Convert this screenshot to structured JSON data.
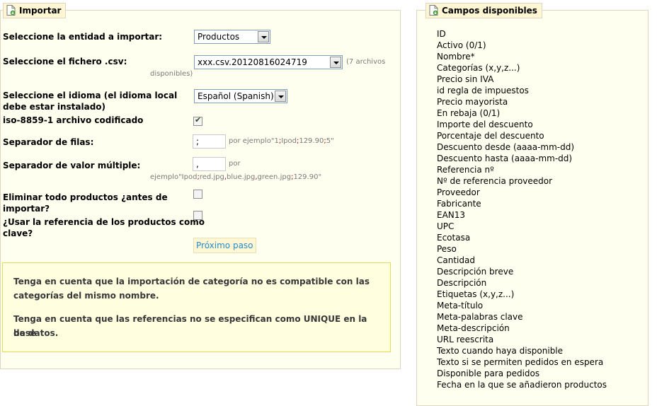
{
  "import": {
    "legend": "Importar",
    "entity_label": "Seleccione la entidad a importar:",
    "entity_value": "Productos",
    "file_label": "Seleccione el fichero .csv:",
    "file_value": "xxx.csv.20120816024719",
    "file_count_a": "(7 archivos",
    "file_count_b": "disponibles)",
    "lang_label_1": "Seleccione el idioma (el idioma local",
    "lang_label_2": "debe estar instalado)",
    "lang_value": "Español (Spanish)",
    "iso_label": "iso-8859-1 archivo codificado",
    "iso_checked": true,
    "row_sep_label": "Separador de filas:",
    "row_sep_value": ";",
    "row_sep_hint": [
      "por ejemplo\"",
      "1",
      ";",
      "Ipod",
      ";",
      "129.90",
      ";",
      "5",
      "\""
    ],
    "multi_sep_label": "Separador de valor múltiple:",
    "multi_sep_value": ",",
    "multi_sep_hint_a": "por",
    "multi_sep_hint_b": [
      "ejemplo\"",
      "Ipod",
      ";",
      "red.jpg",
      ",",
      "blue.jpg",
      ",",
      "green.jpg",
      ";",
      "129.90",
      "\""
    ],
    "delete_label_1": "Eliminar todo productos ¿antes de",
    "delete_label_2": "importar?",
    "ref_key_label_1": "¿Usar la referencia de los productos como",
    "ref_key_label_2": "clave?",
    "next_button": "Próximo paso",
    "notice_1_a": "Tenga en cuenta que la importación de categoría no es compatible con las",
    "notice_1_b": "categorías del mismo nombre.",
    "notice_2_a": "Tenga en cuenta que las referencias no se especifican como UNIQUE en la base",
    "notice_2_b": "de datos."
  },
  "fields": {
    "legend": "Campos disponibles",
    "items": [
      "ID",
      "Activo (0/1)",
      "Nombre*",
      "Categorías (x,y,z...)",
      "Precio sin IVA",
      "id regla de impuestos",
      "Precio mayorista",
      "En rebaja (0/1)",
      "Importe del descuento",
      "Porcentaje del descuento",
      "Descuento desde (aaaa-mm-dd)",
      "Descuento hasta (aaaa-mm-dd)",
      "Referencia nº",
      "Nº de referencia proveedor",
      "Proveedor",
      "Fabricante",
      "EAN13",
      "UPC",
      "Ecotasa",
      "Peso",
      "Cantidad",
      "Descripción breve",
      "Descripción",
      "Etiquetas (x,y,z...)",
      "Meta-título",
      "Meta-palabras clave",
      "Meta-descripción",
      "URL reescrita",
      "Texto cuando haya disponible",
      "Texto si se permiten pedidos en espera",
      "Disponible para pedidos",
      "Fecha en la que se añadieron productos"
    ]
  },
  "colors": {
    "panel_bg": "#fffff0",
    "legend_bg": "#fff6d3",
    "notice_bg": "#ffffe0",
    "link": "#268ccd",
    "separator_hint": "#b00000"
  },
  "icons": {
    "legend_icon": "import-document-icon",
    "fields_legend_icon": "import-document-icon"
  }
}
